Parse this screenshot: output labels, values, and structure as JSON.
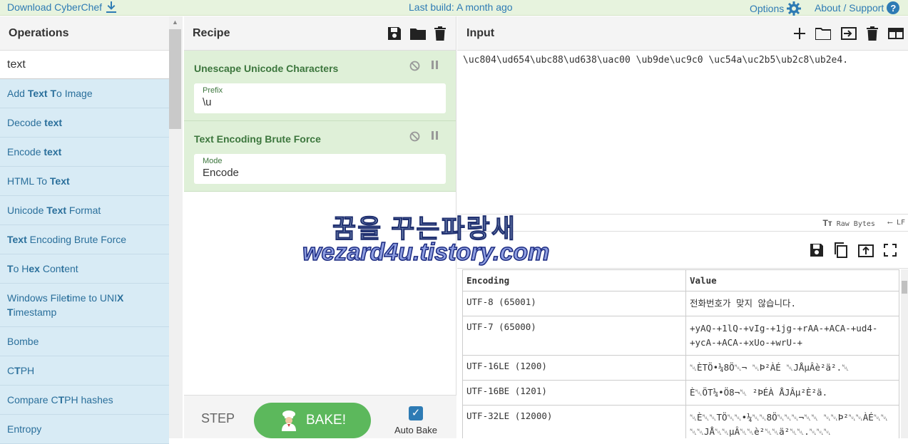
{
  "topbar": {
    "download": "Download CyberChef",
    "build": "Last build: A month ago",
    "options": "Options",
    "about": "About / Support"
  },
  "operations": {
    "title": "Operations",
    "search_value": "text",
    "items": [
      {
        "html": "Add <b>Text</b> <b>T</b>o Image"
      },
      {
        "html": "Decode <b>text</b>"
      },
      {
        "html": "Encode <b>text</b>"
      },
      {
        "html": "HTML To <b>Text</b>"
      },
      {
        "html": "Unicode <b>Text</b> Format"
      },
      {
        "html": "<b>Text</b> Encoding Brute Force"
      },
      {
        "html": "<b>T</b>o H<b>ex</b> Con<b>t</b>ent"
      },
      {
        "html": "Windows File<b>t</b>ime to UNI<b>X</b><br><b>T</b>imestamp",
        "tall": true
      },
      {
        "html": "Bombe"
      },
      {
        "html": "C<b>T</b>PH"
      },
      {
        "html": "Compare C<b>T</b>PH hashes"
      },
      {
        "html": "Entropy"
      }
    ]
  },
  "recipe": {
    "title": "Recipe",
    "ops": [
      {
        "title": "Unescape Unicode Characters",
        "field_label": "Prefix",
        "field_value": "\\u"
      },
      {
        "title": "Text Encoding Brute Force",
        "field_label": "Mode",
        "field_value": "Encode"
      }
    ],
    "step": "STEP",
    "bake": "BAKE!",
    "autobake": "Auto Bake"
  },
  "input": {
    "title": "Input",
    "text": "\\uc804\\ud654\\ubc88\\ud638\\uac00 \\ub9de\\uc9c0 \\uc54a\\uc2b5\\ub2c8\\ub2e4.",
    "status_raw": "Raw Bytes",
    "status_lf": "LF"
  },
  "output": {
    "headers": [
      "Encoding",
      "Value"
    ],
    "rows": [
      [
        "UTF-8 (65001)",
        "전화번호가 맞지 않습니다."
      ],
      [
        "UTF-7 (65000)",
        "+yAQ-+1lQ-+vIg-+1jg-+rAA-+ACA-+ud4-+ycA-+ACA-+xUo-+wrU-+"
      ],
      [
        "UTF-16LE (1200)",
        "␀ÈTÖ•¼8Ö␀¬ ␀Þ²ÀÉ ␀JÅµÂè²ä².␀"
      ],
      [
        "UTF-16BE (1201)",
        "È␀ÖT¼•Ö8¬␀ ²ÞÉÀ ÅJÂµ²È²ä."
      ],
      [
        "UTF-32LE (12000)",
        "␀È␀␀TÖ␀␀•¼␀␀8Ö␀␀␀¬␀␀ ␀␀Þ²␀␀ÀÉ␀␀ ␀␀JÅ␀␀µÂ␀␀è²␀␀ä²␀␀.␀␀␀"
      ]
    ]
  },
  "watermark": {
    "line1": "꿈을 꾸는파랑새",
    "line2": "wezard4u.tistory.com"
  }
}
